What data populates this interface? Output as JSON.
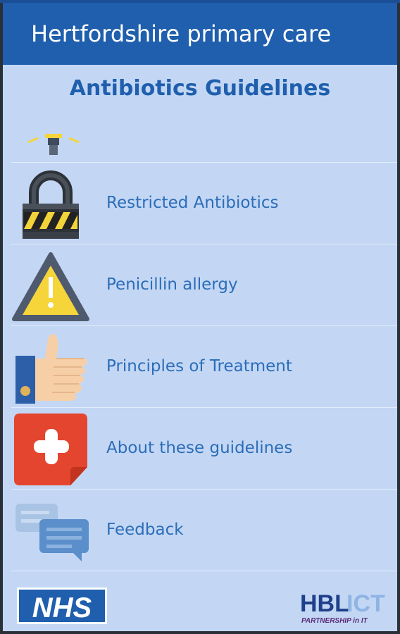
{
  "app_bar": {
    "title": "Hertfordshire primary care"
  },
  "heading": "Antibiotics Guidelines",
  "menu": {
    "items": [
      {
        "label": "Restricted Antibiotics",
        "icon": "padlock-icon"
      },
      {
        "label": "Penicillin allergy",
        "icon": "warning-icon"
      },
      {
        "label": "Principles of Treatment",
        "icon": "thumbs-up-icon"
      },
      {
        "label": "About these guidelines",
        "icon": "first-aid-icon"
      },
      {
        "label": "Feedback",
        "icon": "chat-bubbles-icon"
      }
    ]
  },
  "footer": {
    "nhs_logo_text": "NHS",
    "hbl_logo_text": "HBL",
    "hbl_logo_suffix": "ICT",
    "hbl_tagline": "PARTNERSHIP in IT"
  },
  "colors": {
    "app_bar": "#1f5fad",
    "background": "#c3d7f4",
    "heading": "#1f5fad",
    "menu_text": "#2c6db8"
  }
}
